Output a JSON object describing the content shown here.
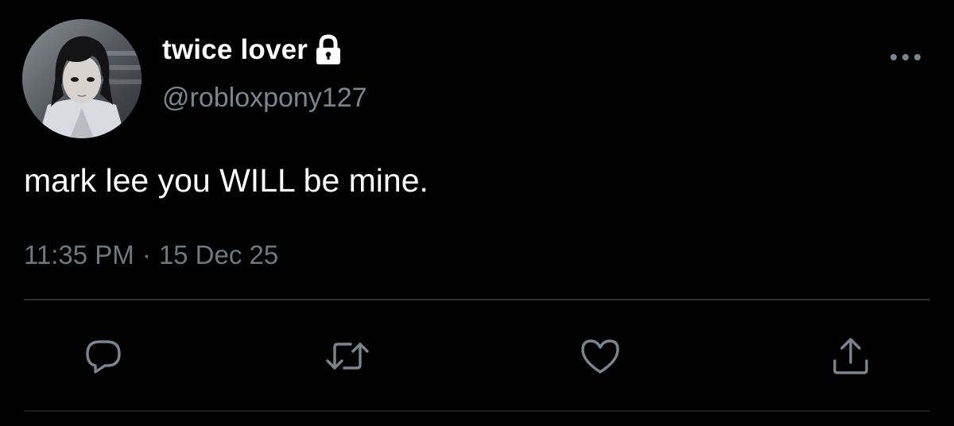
{
  "tweet": {
    "display_name": "twice lover",
    "handle": "@robloxpony127",
    "text": "mark lee you WILL be mine.",
    "time": "11:35 PM",
    "separator": "·",
    "date": "15 Dec 25"
  },
  "icons": {
    "lock": "lock-icon",
    "more": "more-horizontal-icon",
    "reply": "reply-icon",
    "retweet": "retweet-icon",
    "like": "heart-icon",
    "share": "share-icon"
  },
  "colors": {
    "background": "#000000",
    "text_primary": "#ffffff",
    "text_secondary": "#7b8590",
    "icon": "#7b8590",
    "divider": "#2a2d31"
  }
}
